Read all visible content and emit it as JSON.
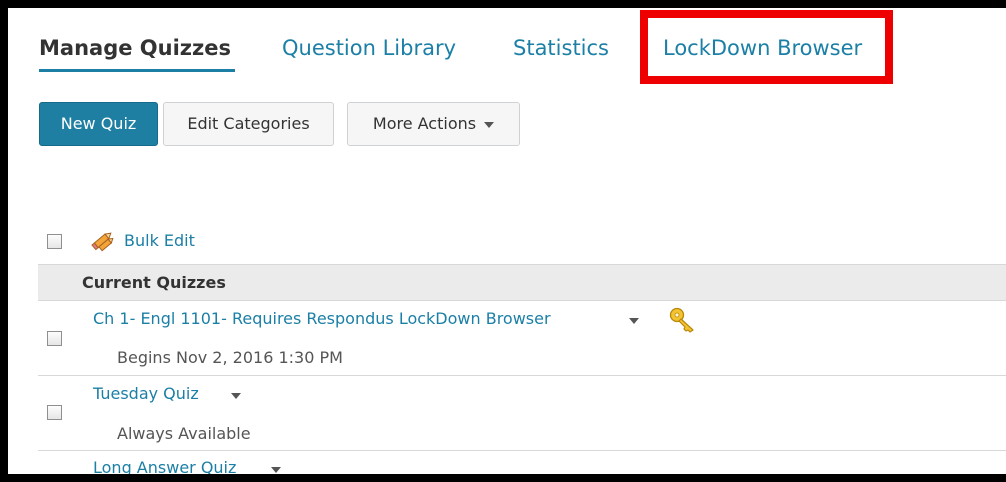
{
  "tabs": [
    {
      "label": "Manage Quizzes",
      "active": true
    },
    {
      "label": "Question Library",
      "active": false
    },
    {
      "label": "Statistics",
      "active": false
    },
    {
      "label": "LockDown Browser",
      "active": false,
      "highlighted": true
    }
  ],
  "toolbar": {
    "new_quiz_label": "New Quiz",
    "edit_categories_label": "Edit Categories",
    "more_actions_label": "More Actions"
  },
  "bulk_edit_label": "Bulk Edit",
  "section": {
    "title": "Current Quizzes"
  },
  "quizzes": [
    {
      "title": "Ch 1- Engl 1101- Requires Respondus LockDown Browser",
      "availability": "Begins Nov 2, 2016 1:30 PM",
      "has_key_icon": true
    },
    {
      "title": "Tuesday Quiz",
      "availability": "Always Available",
      "has_key_icon": false
    },
    {
      "title": "Long Answer Quiz",
      "availability": "",
      "has_key_icon": false
    }
  ],
  "colors": {
    "link": "#1b7fa6",
    "primary_button": "#1e7fa3",
    "highlight": "#ee0000",
    "section_header_bg": "#ebebeb"
  },
  "icons": {
    "bulk_edit": "pencil-icon",
    "lockdown": "key-icon",
    "actions_menu": "chevron-down-icon"
  }
}
